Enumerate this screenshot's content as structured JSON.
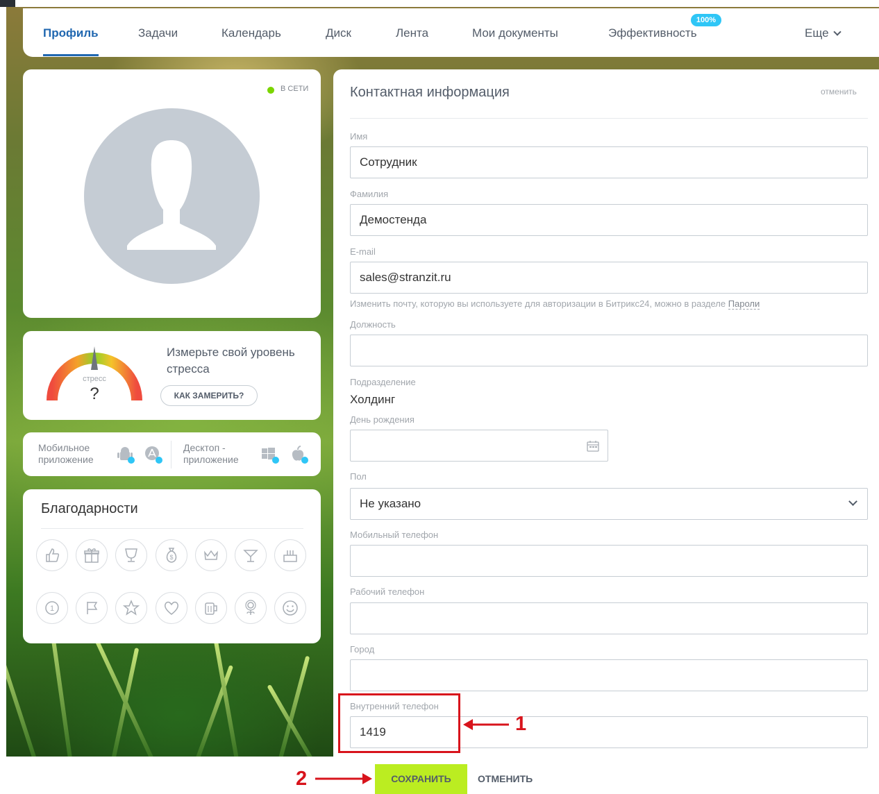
{
  "top_nav": {
    "items": [
      {
        "label": "Профиль",
        "active": true
      },
      {
        "label": "Задачи"
      },
      {
        "label": "Календарь"
      },
      {
        "label": "Диск"
      },
      {
        "label": "Лента"
      },
      {
        "label": "Мои документы"
      },
      {
        "label": "Эффективность"
      },
      {
        "label": "Еще"
      }
    ],
    "efficiency_badge": "100%",
    "colors": {
      "active": "#2067b0",
      "badge": "#2fc6f6"
    }
  },
  "profile_card": {
    "status_label": "в сети",
    "status_color": "#7bd500",
    "avatar_icon": "user-silhouette-icon"
  },
  "stress": {
    "gauge_label": "стресс",
    "gauge_value": "?",
    "title": "Измерьте свой уровень стресса",
    "button_label": "КАК ЗАМЕРИТЬ?"
  },
  "apps": {
    "mobile_label": "Мобильное приложение",
    "desktop_label": "Десктоп - приложение",
    "icons": [
      "android-icon",
      "appstore-icon",
      "windows-icon",
      "apple-icon"
    ]
  },
  "thanks": {
    "title": "Благодарности",
    "badges": [
      "thumbs-up-icon",
      "gift-icon",
      "trophy-icon",
      "money-bag-icon",
      "crown-icon",
      "cocktail-icon",
      "cake-icon",
      "number-one-icon",
      "flag-icon",
      "star-icon",
      "heart-icon",
      "beer-icon",
      "flower-icon",
      "smile-icon"
    ]
  },
  "contact": {
    "title": "Контактная информация",
    "cancel_top": "отменить",
    "fields": {
      "first_name": {
        "label": "Имя",
        "value": "Сотрудник"
      },
      "last_name": {
        "label": "Фамилия",
        "value": "Демостенда"
      },
      "email": {
        "label": "E-mail",
        "value": "sales@stranzit.ru"
      },
      "email_hint": {
        "text": "Изменить почту, которую вы используете для авторизации в Битрикс24, можно в разделе ",
        "link": "Пароли"
      },
      "position": {
        "label": "Должность",
        "value": ""
      },
      "department": {
        "label": "Подразделение",
        "value": "Холдинг"
      },
      "birthday": {
        "label": "День рождения",
        "value": ""
      },
      "gender": {
        "label": "Пол",
        "value": "Не указано"
      },
      "mobile_phone": {
        "label": "Мобильный телефон",
        "value": ""
      },
      "work_phone": {
        "label": "Рабочий телефон",
        "value": ""
      },
      "city": {
        "label": "Город",
        "value": ""
      },
      "internal_phone": {
        "label": "Внутренний телефон",
        "value": "1419"
      }
    }
  },
  "annotations": {
    "marker_1": "1",
    "marker_2": "2",
    "color": "#d8141c"
  },
  "actions": {
    "save_label": "СОХРАНИТЬ",
    "cancel_label": "ОТМЕНИТЬ",
    "save_color": "#bbed21"
  }
}
